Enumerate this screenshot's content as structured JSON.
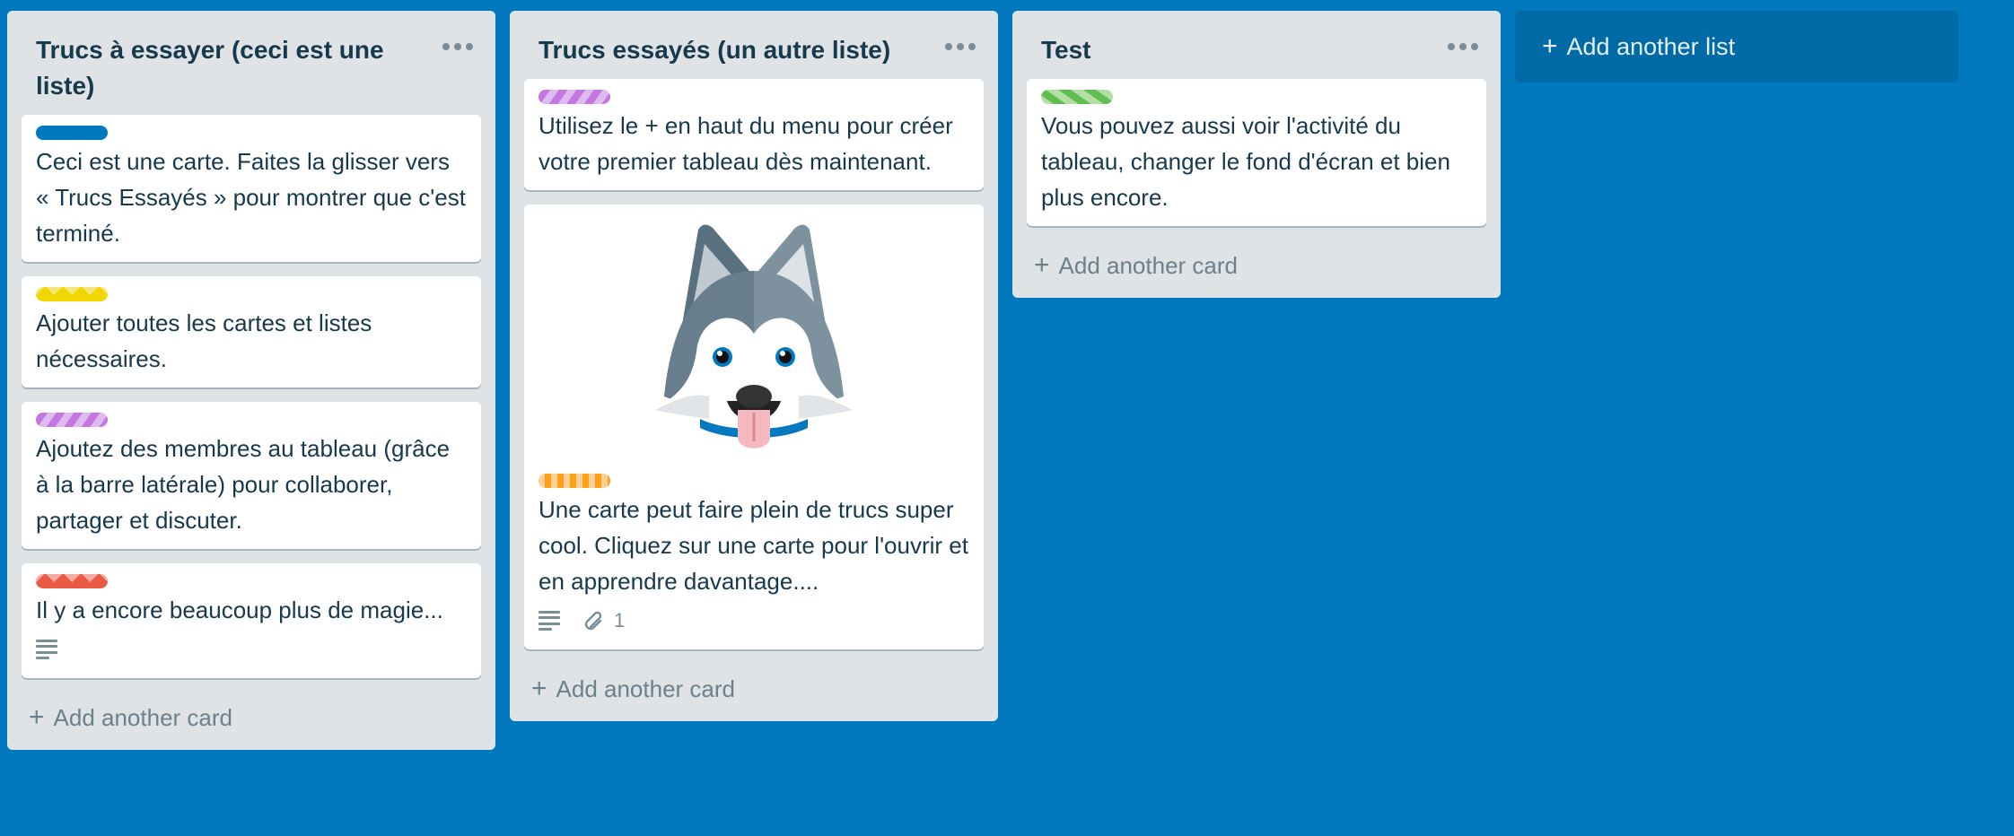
{
  "board": {
    "background_color": "#0079bf",
    "add_list_label": "Add another list"
  },
  "lists": [
    {
      "title": "Trucs à essayer (ceci est une liste)",
      "menu_icon": "ellipsis-icon",
      "add_card_label": "Add another card",
      "cards": [
        {
          "label_color": "blue",
          "text": "Ceci est une carte. Faites la glisser vers « Trucs Essayés » pour montrer que c'est terminé."
        },
        {
          "label_color": "yellow",
          "text": "Ajouter toutes les cartes et listes nécessaires."
        },
        {
          "label_color": "purple",
          "text": "Ajoutez des membres au tableau (grâce à la barre latérale) pour collaborer, partager et discuter."
        },
        {
          "label_color": "red",
          "text": "Il y a encore beaucoup plus de magie...",
          "badges": {
            "description": true
          }
        }
      ]
    },
    {
      "title": "Trucs essayés (un autre liste)",
      "menu_icon": "ellipsis-icon",
      "add_card_label": "Add another card",
      "cards": [
        {
          "label_color": "purple",
          "text": "Utilisez le + en haut du menu pour créer votre premier tableau dès maintenant."
        },
        {
          "cover": "husky-image",
          "label_color": "orange",
          "text": "Une carte peut faire plein de trucs super cool. Cliquez sur une carte pour l'ouvrir et en apprendre davantage....",
          "badges": {
            "description": true,
            "attachments": "1"
          }
        }
      ]
    },
    {
      "title": "Test",
      "menu_icon": "ellipsis-icon",
      "add_card_label": "Add another card",
      "cards": [
        {
          "label_color": "green",
          "text": "Vous pouvez aussi voir l'activité du tableau, changer le fond d'écran et bien plus encore."
        }
      ]
    }
  ],
  "label_colors": {
    "blue": "#0079bf",
    "yellow": "#f2d600",
    "purple": "#c377e0",
    "red": "#eb5a46",
    "orange": "#ff9f1a",
    "green": "#61bd4f"
  }
}
